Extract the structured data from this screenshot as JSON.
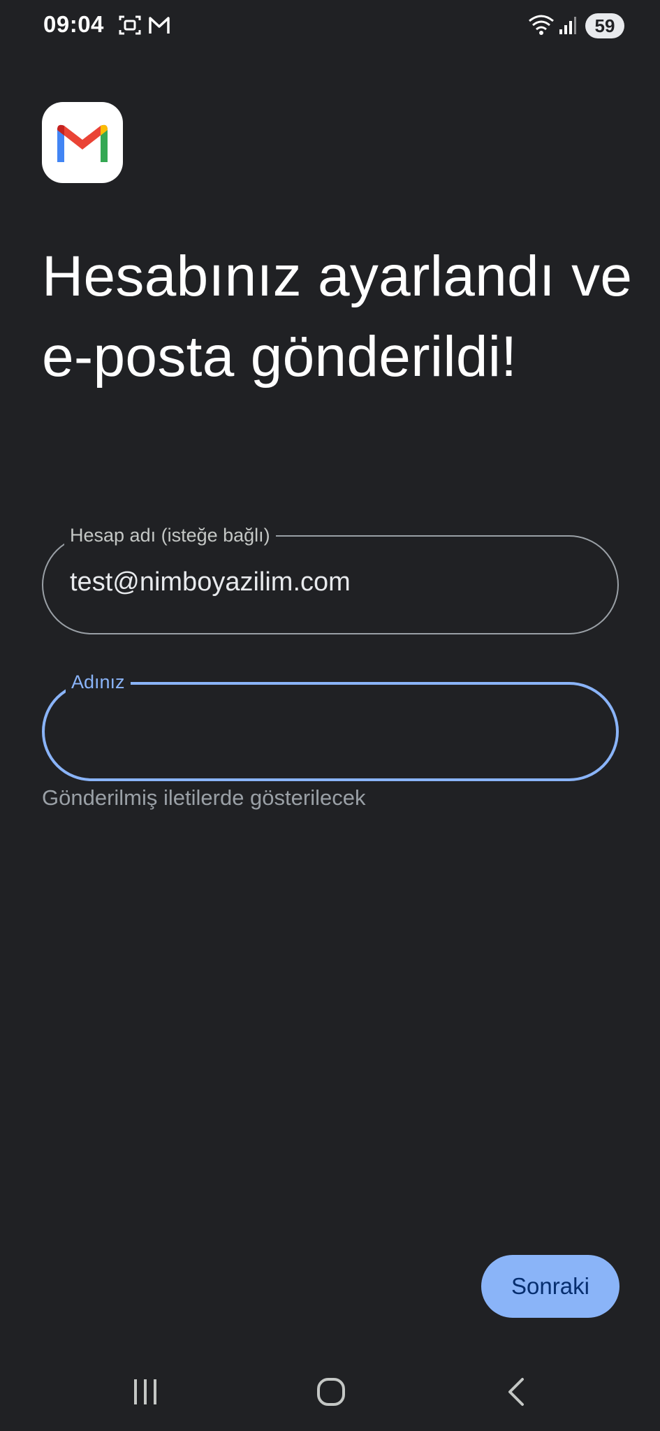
{
  "status_bar": {
    "time": "09:04",
    "battery": "59",
    "icons": [
      "screenshot-icon",
      "gmail-notification-icon",
      "wifi-icon",
      "signal-icon"
    ]
  },
  "app": {
    "logo_icon": "gmail-logo-icon"
  },
  "page": {
    "title": "Hesabınız ayarlandı ve e-posta gönderildi!"
  },
  "form": {
    "account_name": {
      "label": "Hesap adı (isteğe bağlı)",
      "value": "test@nimboyazilim.com"
    },
    "your_name": {
      "label": "Adınız",
      "value": "",
      "helper": "Gönderilmiş iletilerde gösterilecek"
    }
  },
  "actions": {
    "next_label": "Sonraki"
  },
  "nav": {
    "icons": [
      "recents-icon",
      "home-icon",
      "back-icon"
    ]
  },
  "colors": {
    "background": "#202124",
    "accent": "#8ab4f8",
    "outline": "#9aa0a6"
  }
}
